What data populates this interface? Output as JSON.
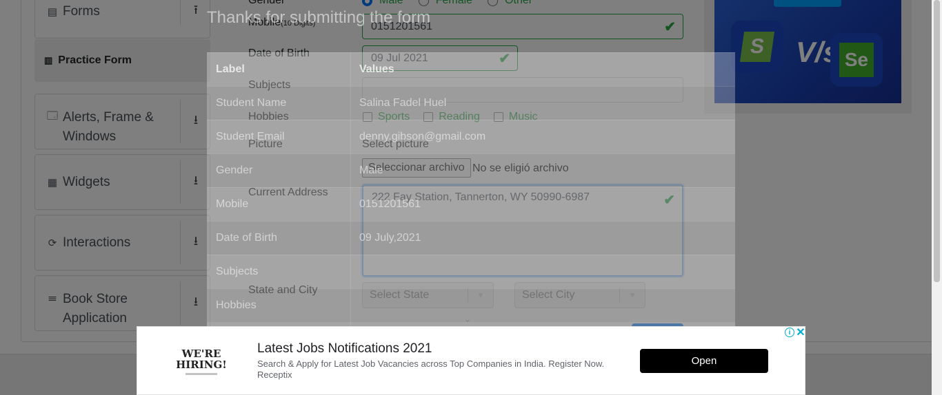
{
  "sidebar": {
    "groups": [
      {
        "label": "Forms",
        "icon": "document-icon",
        "arrow": "up-arrow-icon"
      },
      {
        "label": "Alerts, Frame & Windows",
        "icon": "window-icon",
        "arrow": "down-arrow-icon"
      },
      {
        "label": "Widgets",
        "icon": "widgets-icon",
        "arrow": "down-arrow-icon"
      },
      {
        "label": "Interactions",
        "icon": "interactions-icon",
        "arrow": "down-arrow-icon"
      },
      {
        "label": "Book Store Application",
        "icon": "books-icon",
        "arrow": "down-arrow-icon"
      }
    ],
    "sub_item": "Practice Form"
  },
  "form": {
    "gender_label": "Gender",
    "gender_options": [
      "Male",
      "Female",
      "Other"
    ],
    "mobile_label": "Mobile",
    "mobile_hint": "(10 Digits)",
    "mobile_value": "0151201561",
    "dob_label": "Date of Birth",
    "dob_value": "09 Jul 2021",
    "subjects_label": "Subjects",
    "hobbies_label": "Hobbies",
    "hobbies_options": [
      "Sports",
      "Reading",
      "Music"
    ],
    "picture_label": "Picture",
    "picture_prompt": "Select picture",
    "file_button": "Seleccionar archivo",
    "file_status": "No se eligió archivo",
    "address_label": "Current Address",
    "address_value": "222 Fay Station, Tannerton, WY 50990-6987",
    "state_city_label": "State and City",
    "state_placeholder": "Select State",
    "city_placeholder": "Select City"
  },
  "modal": {
    "title": "Thanks for submitting the form",
    "header": {
      "label": "Label",
      "value": "Values"
    },
    "rows": [
      {
        "label": "Student Name",
        "value": "Salina Fadel Huel"
      },
      {
        "label": "Student Email",
        "value": "denny.gibson@gmail.com"
      },
      {
        "label": "Gender",
        "value": "Male"
      },
      {
        "label": "Mobile",
        "value": "0151201561"
      },
      {
        "label": "Date of Birth",
        "value": "09 July,2021"
      },
      {
        "label": "Subjects",
        "value": ""
      },
      {
        "label": "Hobbies",
        "value": ""
      }
    ]
  },
  "ad": {
    "logo_text_1": "WE'RE",
    "logo_text_2": "HIRING!",
    "title": "Latest Jobs Notifications 2021",
    "description": "Search & Apply for Latest Job Vacancies across Top Companies in India. Register Now.",
    "advertiser": "Receptix",
    "button": "Open",
    "info_icon": "info-icon",
    "close_icon": "close-icon"
  },
  "promo": {
    "left_logo_letter": "S",
    "vs_text": "V/s",
    "right_logo_text": "Se"
  },
  "colors": {
    "success": "#28a745",
    "focus": "#80bdff",
    "ad_button": "#000000",
    "promo_bg": "#1a3fb0"
  }
}
